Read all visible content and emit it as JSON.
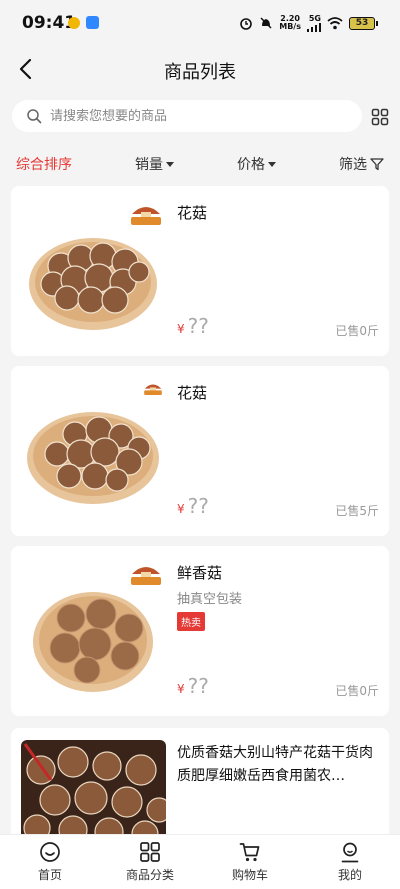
{
  "status": {
    "time": "09:41",
    "speed_top": "2.20",
    "speed_bottom": "MB/s",
    "network": "5G",
    "battery": "53"
  },
  "nav": {
    "title": "商品列表"
  },
  "search": {
    "placeholder": "请搜索您想要的商品",
    "value": ""
  },
  "sort": {
    "items": [
      "综合排序",
      "销量",
      "价格",
      "筛选"
    ],
    "active": "综合排序"
  },
  "products": [
    {
      "name": "花菇",
      "subtitle": "",
      "tag": "",
      "currency": "¥",
      "price": "??",
      "sold": "已售0斤"
    },
    {
      "name": "花菇",
      "subtitle": "",
      "tag": "",
      "currency": "¥",
      "price": "??",
      "sold": "已售5斤"
    },
    {
      "name": "鲜香菇",
      "subtitle": "抽真空包装",
      "tag": "热卖",
      "currency": "¥",
      "price": "??",
      "sold": "已售0斤"
    },
    {
      "name": "优质香菇大别山特产花菇干货肉质肥厚细嫩岳西食用菌农…"
    }
  ],
  "tabs": [
    "首页",
    "商品分类",
    "购物车",
    "我的"
  ],
  "colors": {
    "accent": "#e53935",
    "background": "#f4f4f4"
  }
}
